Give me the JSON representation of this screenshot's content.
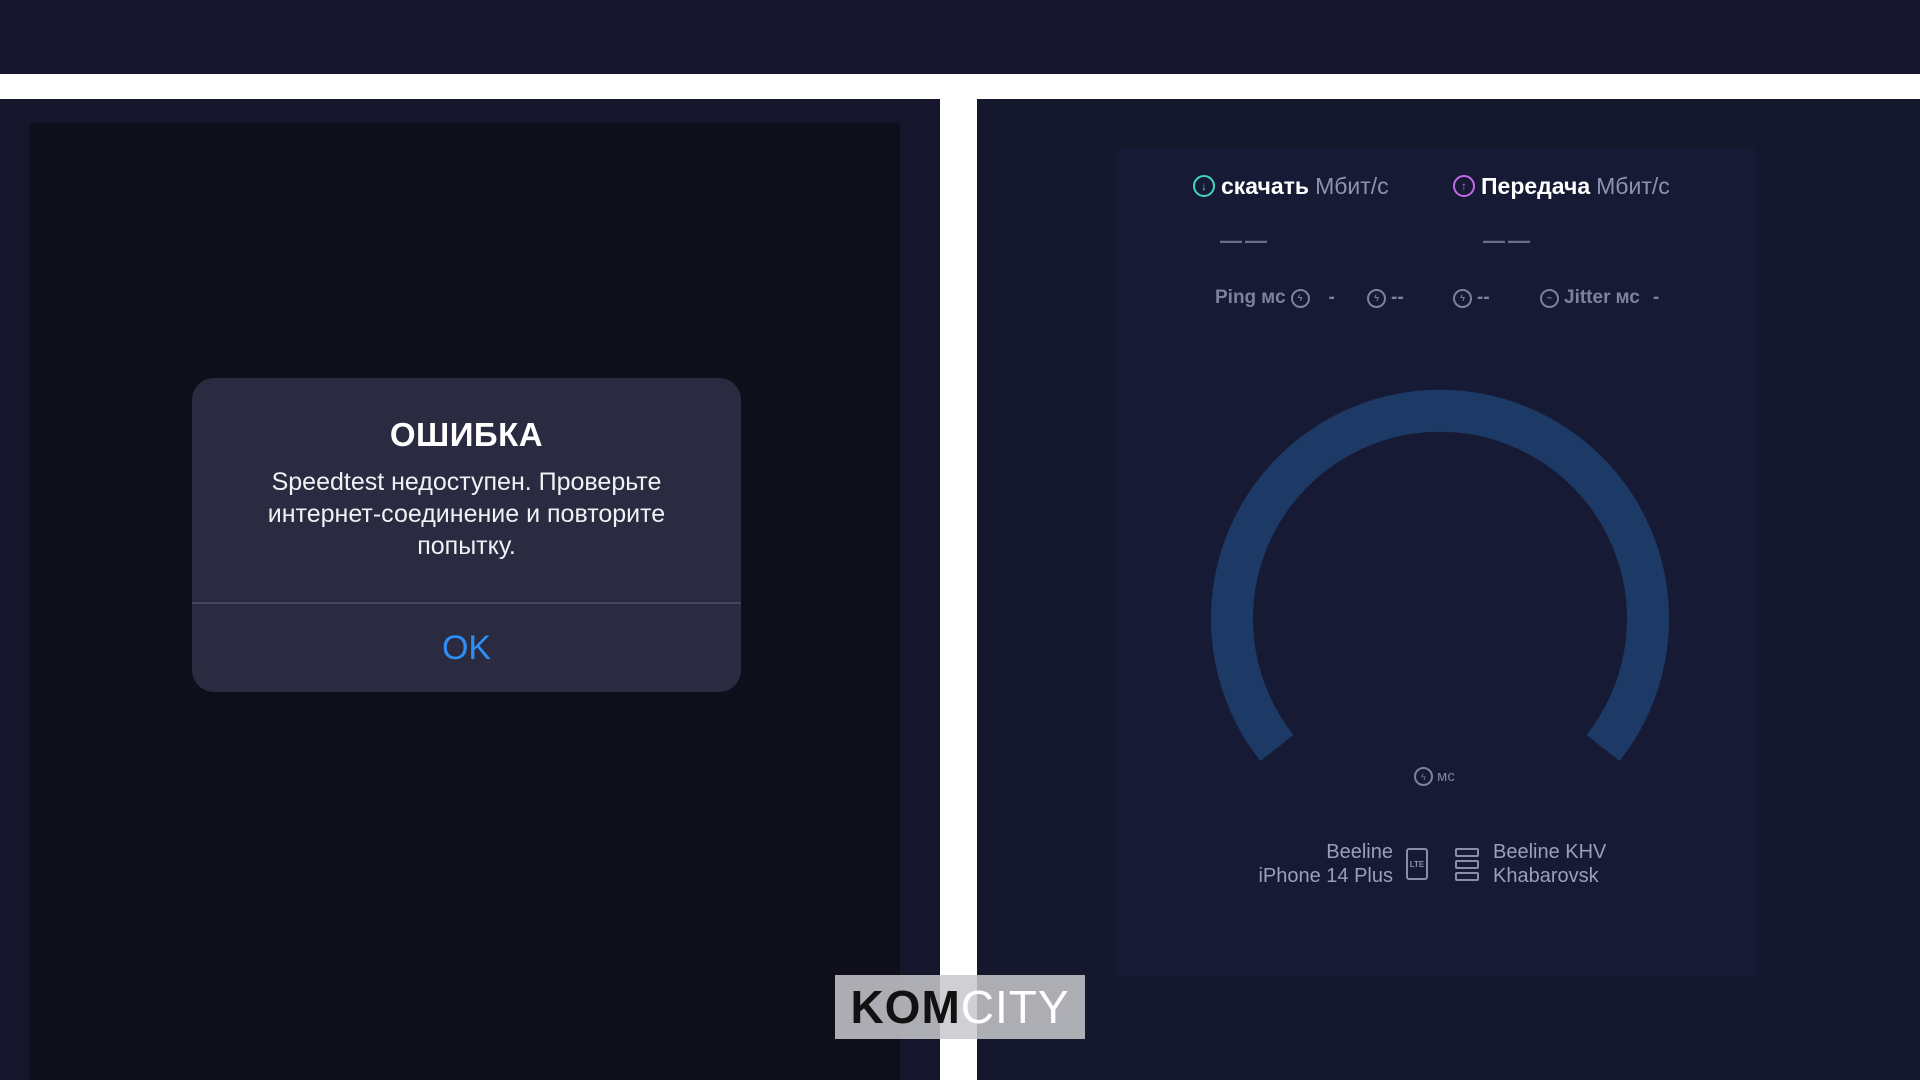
{
  "alert": {
    "title": "ОШИБКА",
    "message": "Speedtest недоступен. Проверьте интернет-соединение и повторите попытку.",
    "ok_label": "OK"
  },
  "speedtest": {
    "download": {
      "label": "скачать",
      "unit": "Мбит/с",
      "value": "——"
    },
    "upload": {
      "label": "Передача",
      "unit": "Мбит/с",
      "value": "——"
    },
    "ping": {
      "label": "Ping",
      "unit": "мс",
      "value": "-"
    },
    "ping_down_value": "--",
    "ping_up_value": "--",
    "jitter": {
      "label": "Jitter",
      "unit": "мс",
      "value": "-"
    },
    "gauge_unit": "мс",
    "provider": {
      "name": "Beeline",
      "device": "iPhone 14 Plus"
    },
    "server": {
      "name": "Beeline KHV",
      "city": "Khabarovsk"
    },
    "lte_label": "LTE"
  },
  "watermark": {
    "part1": "KOM",
    "part2": "CITY"
  },
  "colors": {
    "accent_ok": "#2f8ef5",
    "download_icon": "#3fd6c6",
    "upload_icon": "#c46ae8",
    "gauge_arc": "#1d3a66"
  }
}
